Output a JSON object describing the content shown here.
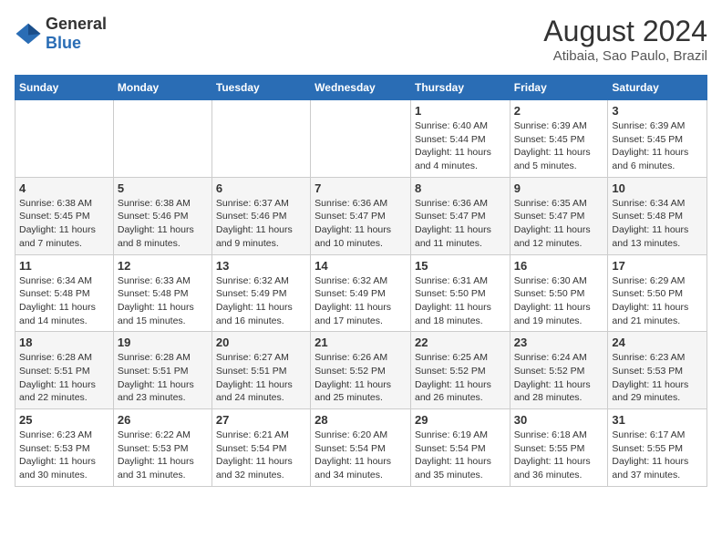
{
  "header": {
    "logo_general": "General",
    "logo_blue": "Blue",
    "month_year": "August 2024",
    "location": "Atibaia, Sao Paulo, Brazil"
  },
  "days_of_week": [
    "Sunday",
    "Monday",
    "Tuesday",
    "Wednesday",
    "Thursday",
    "Friday",
    "Saturday"
  ],
  "weeks": [
    [
      {
        "day": "",
        "info": ""
      },
      {
        "day": "",
        "info": ""
      },
      {
        "day": "",
        "info": ""
      },
      {
        "day": "",
        "info": ""
      },
      {
        "day": "1",
        "info": "Sunrise: 6:40 AM\nSunset: 5:44 PM\nDaylight: 11 hours and 4 minutes."
      },
      {
        "day": "2",
        "info": "Sunrise: 6:39 AM\nSunset: 5:45 PM\nDaylight: 11 hours and 5 minutes."
      },
      {
        "day": "3",
        "info": "Sunrise: 6:39 AM\nSunset: 5:45 PM\nDaylight: 11 hours and 6 minutes."
      }
    ],
    [
      {
        "day": "4",
        "info": "Sunrise: 6:38 AM\nSunset: 5:45 PM\nDaylight: 11 hours and 7 minutes."
      },
      {
        "day": "5",
        "info": "Sunrise: 6:38 AM\nSunset: 5:46 PM\nDaylight: 11 hours and 8 minutes."
      },
      {
        "day": "6",
        "info": "Sunrise: 6:37 AM\nSunset: 5:46 PM\nDaylight: 11 hours and 9 minutes."
      },
      {
        "day": "7",
        "info": "Sunrise: 6:36 AM\nSunset: 5:47 PM\nDaylight: 11 hours and 10 minutes."
      },
      {
        "day": "8",
        "info": "Sunrise: 6:36 AM\nSunset: 5:47 PM\nDaylight: 11 hours and 11 minutes."
      },
      {
        "day": "9",
        "info": "Sunrise: 6:35 AM\nSunset: 5:47 PM\nDaylight: 11 hours and 12 minutes."
      },
      {
        "day": "10",
        "info": "Sunrise: 6:34 AM\nSunset: 5:48 PM\nDaylight: 11 hours and 13 minutes."
      }
    ],
    [
      {
        "day": "11",
        "info": "Sunrise: 6:34 AM\nSunset: 5:48 PM\nDaylight: 11 hours and 14 minutes."
      },
      {
        "day": "12",
        "info": "Sunrise: 6:33 AM\nSunset: 5:48 PM\nDaylight: 11 hours and 15 minutes."
      },
      {
        "day": "13",
        "info": "Sunrise: 6:32 AM\nSunset: 5:49 PM\nDaylight: 11 hours and 16 minutes."
      },
      {
        "day": "14",
        "info": "Sunrise: 6:32 AM\nSunset: 5:49 PM\nDaylight: 11 hours and 17 minutes."
      },
      {
        "day": "15",
        "info": "Sunrise: 6:31 AM\nSunset: 5:50 PM\nDaylight: 11 hours and 18 minutes."
      },
      {
        "day": "16",
        "info": "Sunrise: 6:30 AM\nSunset: 5:50 PM\nDaylight: 11 hours and 19 minutes."
      },
      {
        "day": "17",
        "info": "Sunrise: 6:29 AM\nSunset: 5:50 PM\nDaylight: 11 hours and 21 minutes."
      }
    ],
    [
      {
        "day": "18",
        "info": "Sunrise: 6:28 AM\nSunset: 5:51 PM\nDaylight: 11 hours and 22 minutes."
      },
      {
        "day": "19",
        "info": "Sunrise: 6:28 AM\nSunset: 5:51 PM\nDaylight: 11 hours and 23 minutes."
      },
      {
        "day": "20",
        "info": "Sunrise: 6:27 AM\nSunset: 5:51 PM\nDaylight: 11 hours and 24 minutes."
      },
      {
        "day": "21",
        "info": "Sunrise: 6:26 AM\nSunset: 5:52 PM\nDaylight: 11 hours and 25 minutes."
      },
      {
        "day": "22",
        "info": "Sunrise: 6:25 AM\nSunset: 5:52 PM\nDaylight: 11 hours and 26 minutes."
      },
      {
        "day": "23",
        "info": "Sunrise: 6:24 AM\nSunset: 5:52 PM\nDaylight: 11 hours and 28 minutes."
      },
      {
        "day": "24",
        "info": "Sunrise: 6:23 AM\nSunset: 5:53 PM\nDaylight: 11 hours and 29 minutes."
      }
    ],
    [
      {
        "day": "25",
        "info": "Sunrise: 6:23 AM\nSunset: 5:53 PM\nDaylight: 11 hours and 30 minutes."
      },
      {
        "day": "26",
        "info": "Sunrise: 6:22 AM\nSunset: 5:53 PM\nDaylight: 11 hours and 31 minutes."
      },
      {
        "day": "27",
        "info": "Sunrise: 6:21 AM\nSunset: 5:54 PM\nDaylight: 11 hours and 32 minutes."
      },
      {
        "day": "28",
        "info": "Sunrise: 6:20 AM\nSunset: 5:54 PM\nDaylight: 11 hours and 34 minutes."
      },
      {
        "day": "29",
        "info": "Sunrise: 6:19 AM\nSunset: 5:54 PM\nDaylight: 11 hours and 35 minutes."
      },
      {
        "day": "30",
        "info": "Sunrise: 6:18 AM\nSunset: 5:55 PM\nDaylight: 11 hours and 36 minutes."
      },
      {
        "day": "31",
        "info": "Sunrise: 6:17 AM\nSunset: 5:55 PM\nDaylight: 11 hours and 37 minutes."
      }
    ]
  ]
}
